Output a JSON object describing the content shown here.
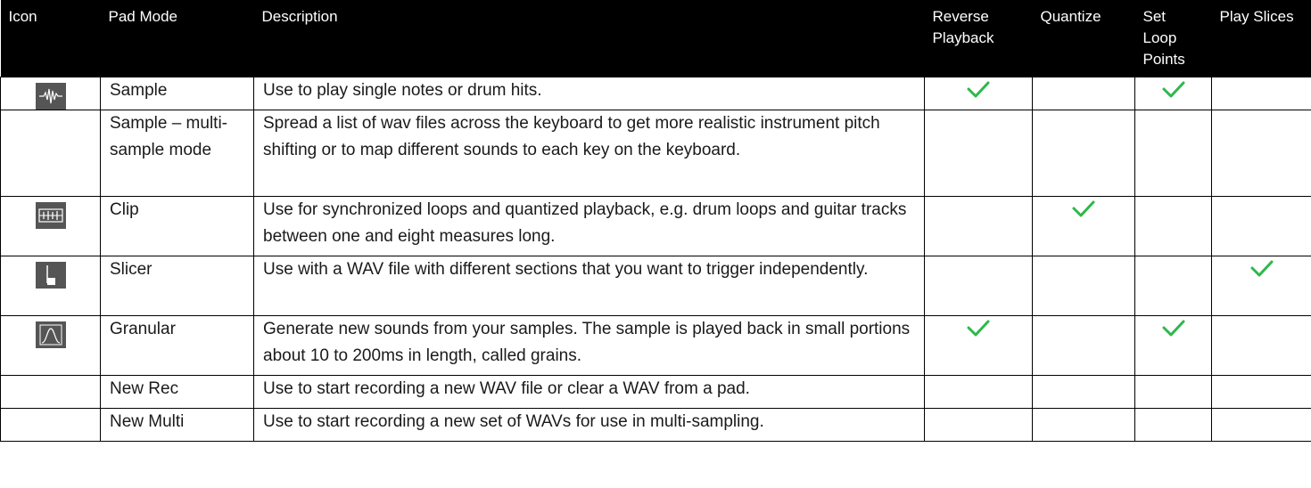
{
  "headers": {
    "icon": "Icon",
    "pad_mode": "Pad Mode",
    "description": "Description",
    "reverse": "Reverse Playback",
    "quantize": "Quantize",
    "loop": "Set Loop Points",
    "slices": "Play Slices"
  },
  "rows": [
    {
      "icon": "waveform-icon",
      "mode": "Sample",
      "description": "Use to play single notes or drum hits.",
      "reverse": true,
      "quantize": false,
      "loop": true,
      "slices": false
    },
    {
      "icon": "",
      "mode": "Sample – multi-sample mode",
      "description": "Spread a list of wav files across the keyboard to get more realistic instrument pitch shifting or to map different sounds to each key on the keyboard.",
      "reverse": false,
      "quantize": false,
      "loop": false,
      "slices": false
    },
    {
      "icon": "clip-icon",
      "mode": "Clip",
      "description": "Use for synchronized loops and quantized playback, e.g. drum loops and guitar tracks between one and eight measures long.",
      "reverse": false,
      "quantize": true,
      "loop": false,
      "slices": false
    },
    {
      "icon": "slicer-icon",
      "mode": "Slicer",
      "description": "Use with a WAV file with different sections that you want to trigger independently.",
      "reverse": false,
      "quantize": false,
      "loop": false,
      "slices": true
    },
    {
      "icon": "granular-icon",
      "mode": "Granular",
      "description": "Generate new sounds from your samples. The sample is played back in small portions about 10 to 200ms in length, called grains.",
      "reverse": true,
      "quantize": false,
      "loop": true,
      "slices": false
    },
    {
      "icon": "",
      "mode": "New Rec",
      "description": "Use to start recording a new WAV file or clear a WAV from a pad.",
      "reverse": false,
      "quantize": false,
      "loop": false,
      "slices": false
    },
    {
      "icon": "",
      "mode": "New Multi",
      "description": "Use to start recording a new set of WAVs for use in multi-sampling.",
      "reverse": false,
      "quantize": false,
      "loop": false,
      "slices": false
    }
  ],
  "colors": {
    "header_bg": "#000000",
    "header_text": "#ffffff",
    "check": "#2db84b",
    "icon_bg": "#555555"
  }
}
